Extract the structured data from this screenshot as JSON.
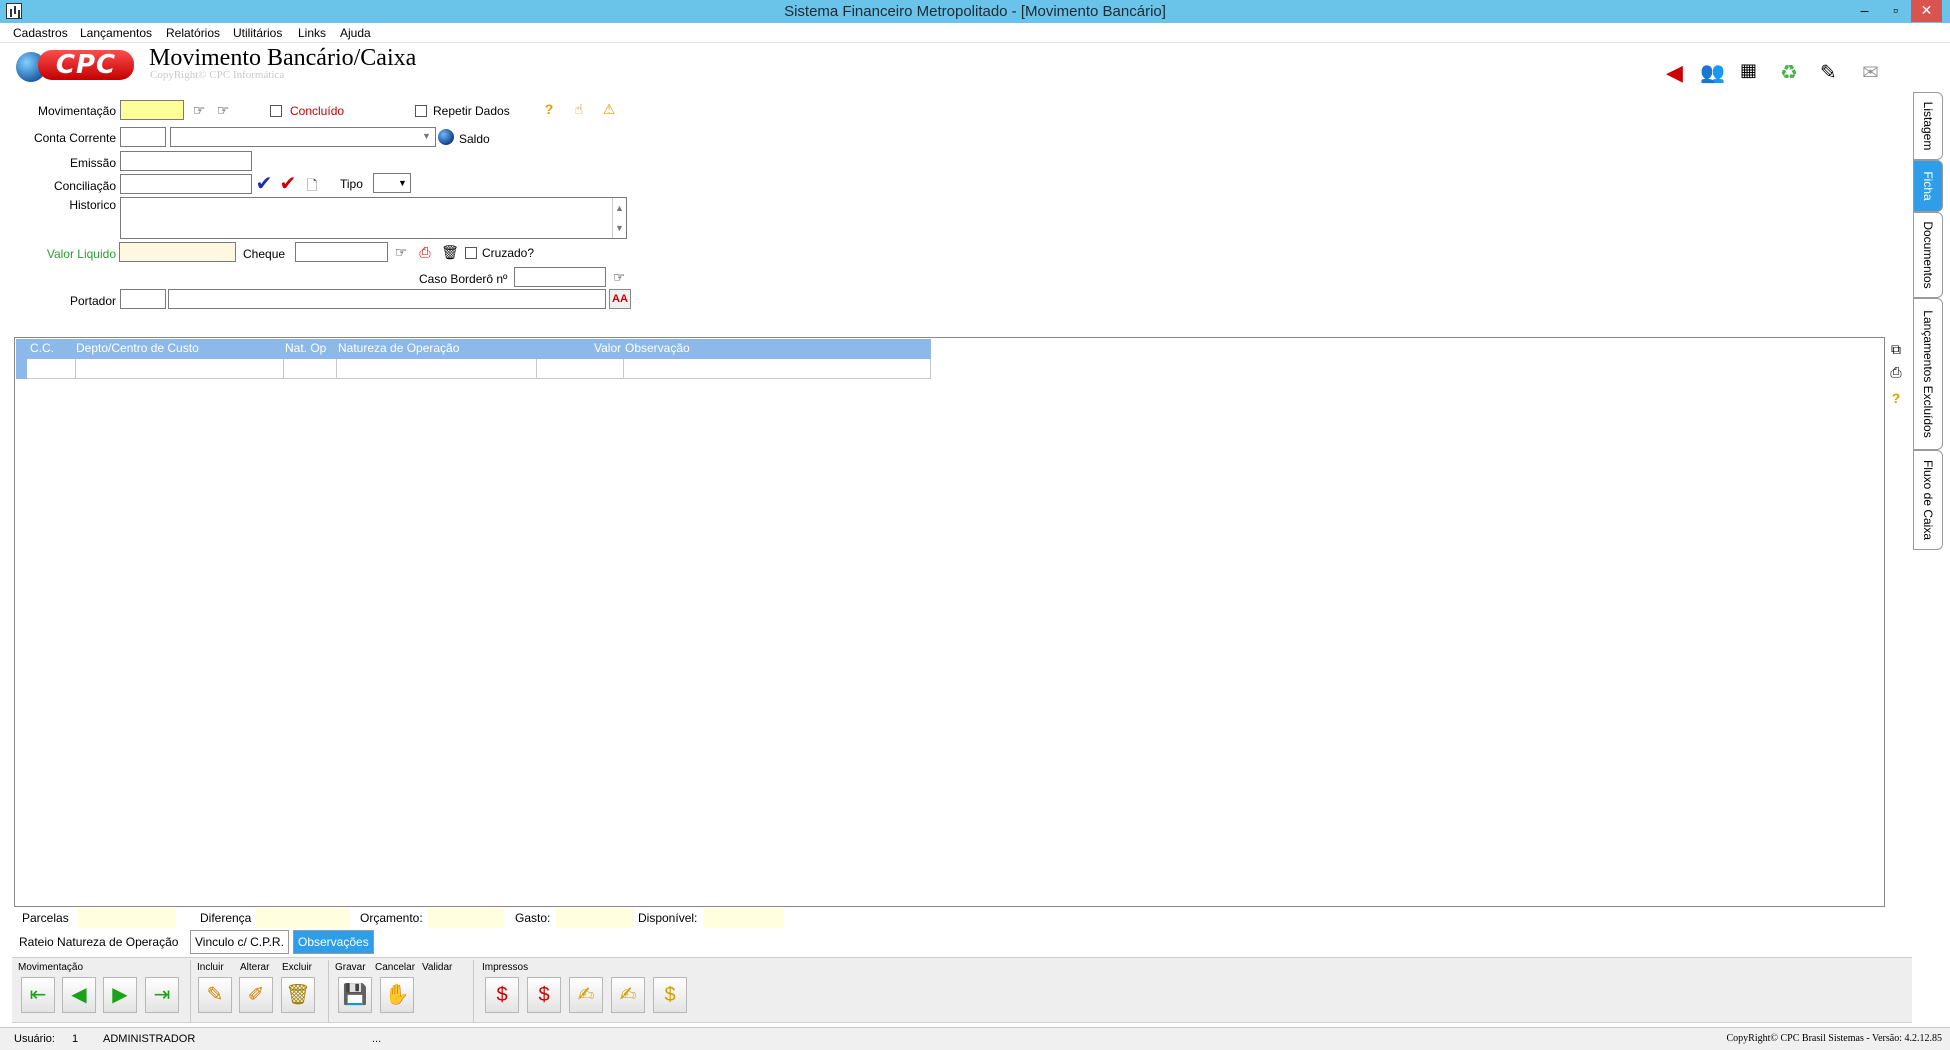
{
  "window": {
    "title": "Sistema Financeiro Metropolitado - [Movimento Bancário]",
    "controls": [
      "–",
      "▫",
      "✕"
    ]
  },
  "menu": [
    "Cadastros",
    "Lançamentos",
    "Relatórios",
    "Utilitários",
    "Links",
    "Ajuda"
  ],
  "header": {
    "logo_text": "CPC",
    "title": "Movimento Bancário/Caixa",
    "subtitle": "CopyRight© CPC Informática"
  },
  "form": {
    "movimentacao_label": "Movimentação",
    "movimentacao_value": "",
    "concluido_label": "Concluído",
    "repetir_label": "Repetir Dados",
    "conta_label": "Conta Corrente",
    "saldo_label": "Saldo",
    "emissao_label": "Emissão",
    "conciliacao_label": "Conciliação",
    "tipo_label": "Tipo",
    "historico_label": "Historico",
    "valor_label": "Valor Liquido",
    "cheque_label": "Cheque",
    "cruzado_label": "Cruzado?",
    "bordero_label": "Caso Borderô nº",
    "portador_label": "Portador"
  },
  "grid": {
    "columns": [
      "C.C.",
      "Depto/Centro de Custo",
      "Nat. Op",
      "Natureza de Operação",
      "Valor",
      "Observação"
    ]
  },
  "side_tabs": [
    "Listagem",
    "Ficha",
    "Documentos",
    "Lançamentos Excluídos",
    "Fluxo de Caixa"
  ],
  "totals": {
    "parcelas": "Parcelas",
    "diferenca": "Diferença",
    "orcamento": "Orçamento:",
    "gasto": "Gasto:",
    "disponivel": "Disponível:"
  },
  "bottom_tabs": [
    "Rateio Natureza de Operação",
    "Vinculo c/ C.P.R.",
    "Observações"
  ],
  "toolbar": {
    "movimentacao": "Movimentação",
    "incluir": "Incluir",
    "alterar": "Alterar",
    "excluir": "Excluir",
    "gravar": "Gravar",
    "cancelar": "Cancelar",
    "validar": "Validar",
    "impressos": "Impressos"
  },
  "status": {
    "usuario_label": "Usuário:",
    "usuario_id": "1",
    "usuario_nome": "ADMINISTRADOR",
    "dots": "...",
    "copyright": "CopyRight© CPC Brasil Sistemas - Versão: 4.2.12.85"
  },
  "colors": {
    "titlebar": "#6ac3e8",
    "grid_header": "#8cb8ea",
    "active_tab": "#2e9ee8",
    "required_field": "#ffff99",
    "label_red": "#cc0000",
    "label_green": "#2e9e2e"
  }
}
